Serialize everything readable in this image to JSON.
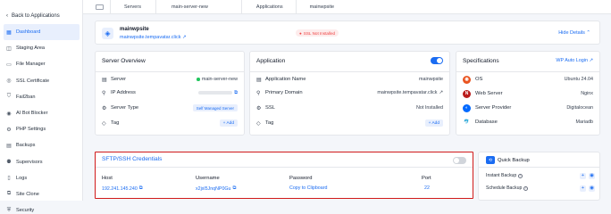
{
  "sidebar": {
    "back_label": "Back to Applications",
    "items": [
      {
        "label": "Dashboard",
        "icon": "grid-icon"
      },
      {
        "label": "Staging Area",
        "icon": "layers-icon"
      },
      {
        "label": "File Manager",
        "icon": "file-icon"
      },
      {
        "label": "SSL Certificate",
        "icon": "certificate-icon"
      },
      {
        "label": "Fail2ban",
        "icon": "shield-icon"
      },
      {
        "label": "AI Bot Blocker",
        "icon": "bot-icon"
      },
      {
        "label": "PHP Settings",
        "icon": "php-icon"
      },
      {
        "label": "Backups",
        "icon": "backup-icon"
      },
      {
        "label": "Supervisors",
        "icon": "supervisor-icon"
      },
      {
        "label": "Logs",
        "icon": "logs-icon"
      },
      {
        "label": "Site Clone",
        "icon": "clone-icon"
      },
      {
        "label": "Security",
        "icon": "lock-icon"
      }
    ]
  },
  "breadcrumbs": [
    "Servers",
    "main-server-new",
    "Applications",
    "mainwpsite"
  ],
  "site": {
    "name": "mainwpsite",
    "link": "mainwpsite.tempavatar.click",
    "ssl_badge": "SSL Not Installed",
    "hide_details": "Hide Details"
  },
  "server_overview": {
    "title": "Server Overview",
    "rows": {
      "server": {
        "label": "Server",
        "value": "main-server-new"
      },
      "ip": {
        "label": "IP Address"
      },
      "type": {
        "label": "Server Type",
        "value": "Self Managed Server"
      },
      "tag": {
        "label": "Tag",
        "action": "+ Add"
      }
    }
  },
  "application": {
    "title": "Application",
    "rows": {
      "name": {
        "label": "Application Name",
        "value": "mainwpsite"
      },
      "domain": {
        "label": "Primary Domain",
        "value": "mainwpsite.tempavatar.click"
      },
      "ssl": {
        "label": "SSL",
        "value": "Not Installed"
      },
      "tag": {
        "label": "Tag",
        "action": "+ Add"
      }
    }
  },
  "specifications": {
    "title": "Specifications",
    "wp_auto_login": "WP Auto Login",
    "rows": {
      "os": {
        "label": "OS",
        "value": "Ubuntu 24.04"
      },
      "web": {
        "label": "Web Server",
        "value": "Nginx"
      },
      "provider": {
        "label": "Server Provider",
        "value": "Digitalocean"
      },
      "db": {
        "label": "Database",
        "value": "Mariadb"
      }
    }
  },
  "credentials": {
    "title": "SFTP/SSH Credentials",
    "columns": {
      "host": {
        "header": "Host",
        "value": "192.241.145.240"
      },
      "username": {
        "header": "Username",
        "value": "x2jxl5JnqNP0Gu"
      },
      "password": {
        "header": "Password",
        "value": "Copy to Clipboard"
      },
      "port": {
        "header": "Port",
        "value": "22"
      }
    }
  },
  "quick_backup": {
    "title": "Quick Backup",
    "rows": {
      "instant": {
        "label": "Instant Backup"
      },
      "schedule": {
        "label": "Schedule Backup"
      }
    }
  },
  "colors": {
    "accent": "#1a6cf2",
    "danger": "#ef4444",
    "success": "#22c55e",
    "highlight_border": "#d11a1a"
  }
}
